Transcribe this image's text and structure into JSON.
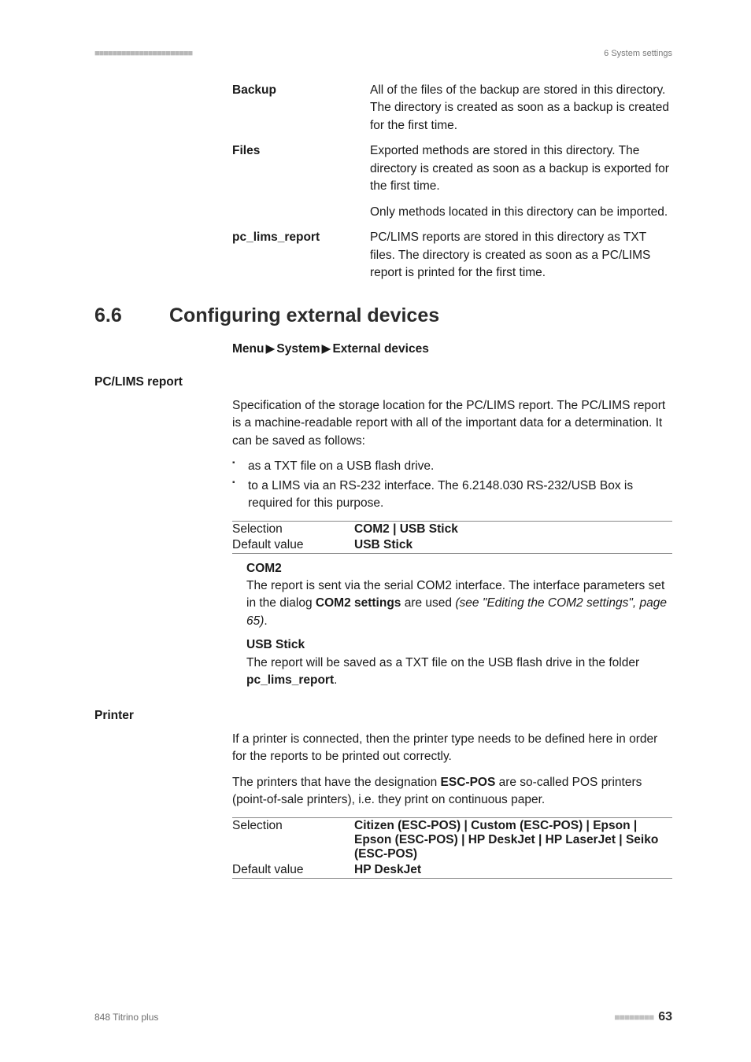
{
  "header": {
    "dots": "■■■■■■■■■■■■■■■■■■■■■■",
    "right": "6 System settings"
  },
  "defs": {
    "backup": {
      "term": "Backup",
      "desc": "All of the files of the backup are stored in this directory. The directory is created as soon as a backup is created for the first time."
    },
    "files": {
      "term": "Files",
      "desc": "Exported methods are stored in this directory. The directory is created as soon as a backup is exported for the first time.",
      "extra": "Only methods located in this directory can be imported."
    },
    "pclims": {
      "term": "pc_lims_report",
      "desc": "PC/LIMS reports are stored in this directory as TXT files. The directory is created as soon as a PC/LIMS report is printed for the first time."
    }
  },
  "section": {
    "num": "6.6",
    "title": "Configuring external devices"
  },
  "menu": {
    "a": "Menu",
    "b": "System",
    "c": "External devices"
  },
  "pclims_report": {
    "heading": "PC/LIMS report",
    "intro": "Specification of the storage location for the PC/LIMS report. The PC/LIMS report is a machine-readable report with all of the important data for a determination. It can be saved as follows:",
    "bullet1": "as a TXT file on a USB flash drive.",
    "bullet2": "to a LIMS via an RS-232 interface. The 6.2148.030 RS-232/USB Box is required for this purpose.",
    "selection_label": "Selection",
    "selection_value": "COM2 | USB Stick",
    "default_label": "Default value",
    "default_value": "USB Stick",
    "com2": {
      "title": "COM2",
      "body_a": "The report is sent via the serial COM2 interface. The interface parameters set in the dialog ",
      "body_b": "COM2 settings",
      "body_c": " are used ",
      "body_d": "(see \"Editing the COM2 settings\", page 65)",
      "body_e": "."
    },
    "usb": {
      "title": "USB Stick",
      "body_a": "The report will be saved as a TXT file on the USB flash drive in the folder ",
      "body_b": "pc_lims_report",
      "body_c": "."
    }
  },
  "printer": {
    "heading": "Printer",
    "intro1": "If a printer is connected, then the printer type needs to be defined here in order for the reports to be printed out correctly.",
    "intro2_a": "The printers that have the designation ",
    "intro2_b": "ESC-POS",
    "intro2_c": " are so-called POS printers (point-of-sale printers), i.e. they print on continuous paper.",
    "selection_label": "Selection",
    "selection_value": "Citizen (ESC-POS) | Custom (ESC-POS) | Epson | Epson (ESC-POS) | HP DeskJet | HP LaserJet | Seiko (ESC-POS)",
    "default_label": "Default value",
    "default_value": "HP DeskJet"
  },
  "footer": {
    "left": "848 Titrino plus",
    "dots": "■■■■■■■■",
    "page": "63"
  }
}
